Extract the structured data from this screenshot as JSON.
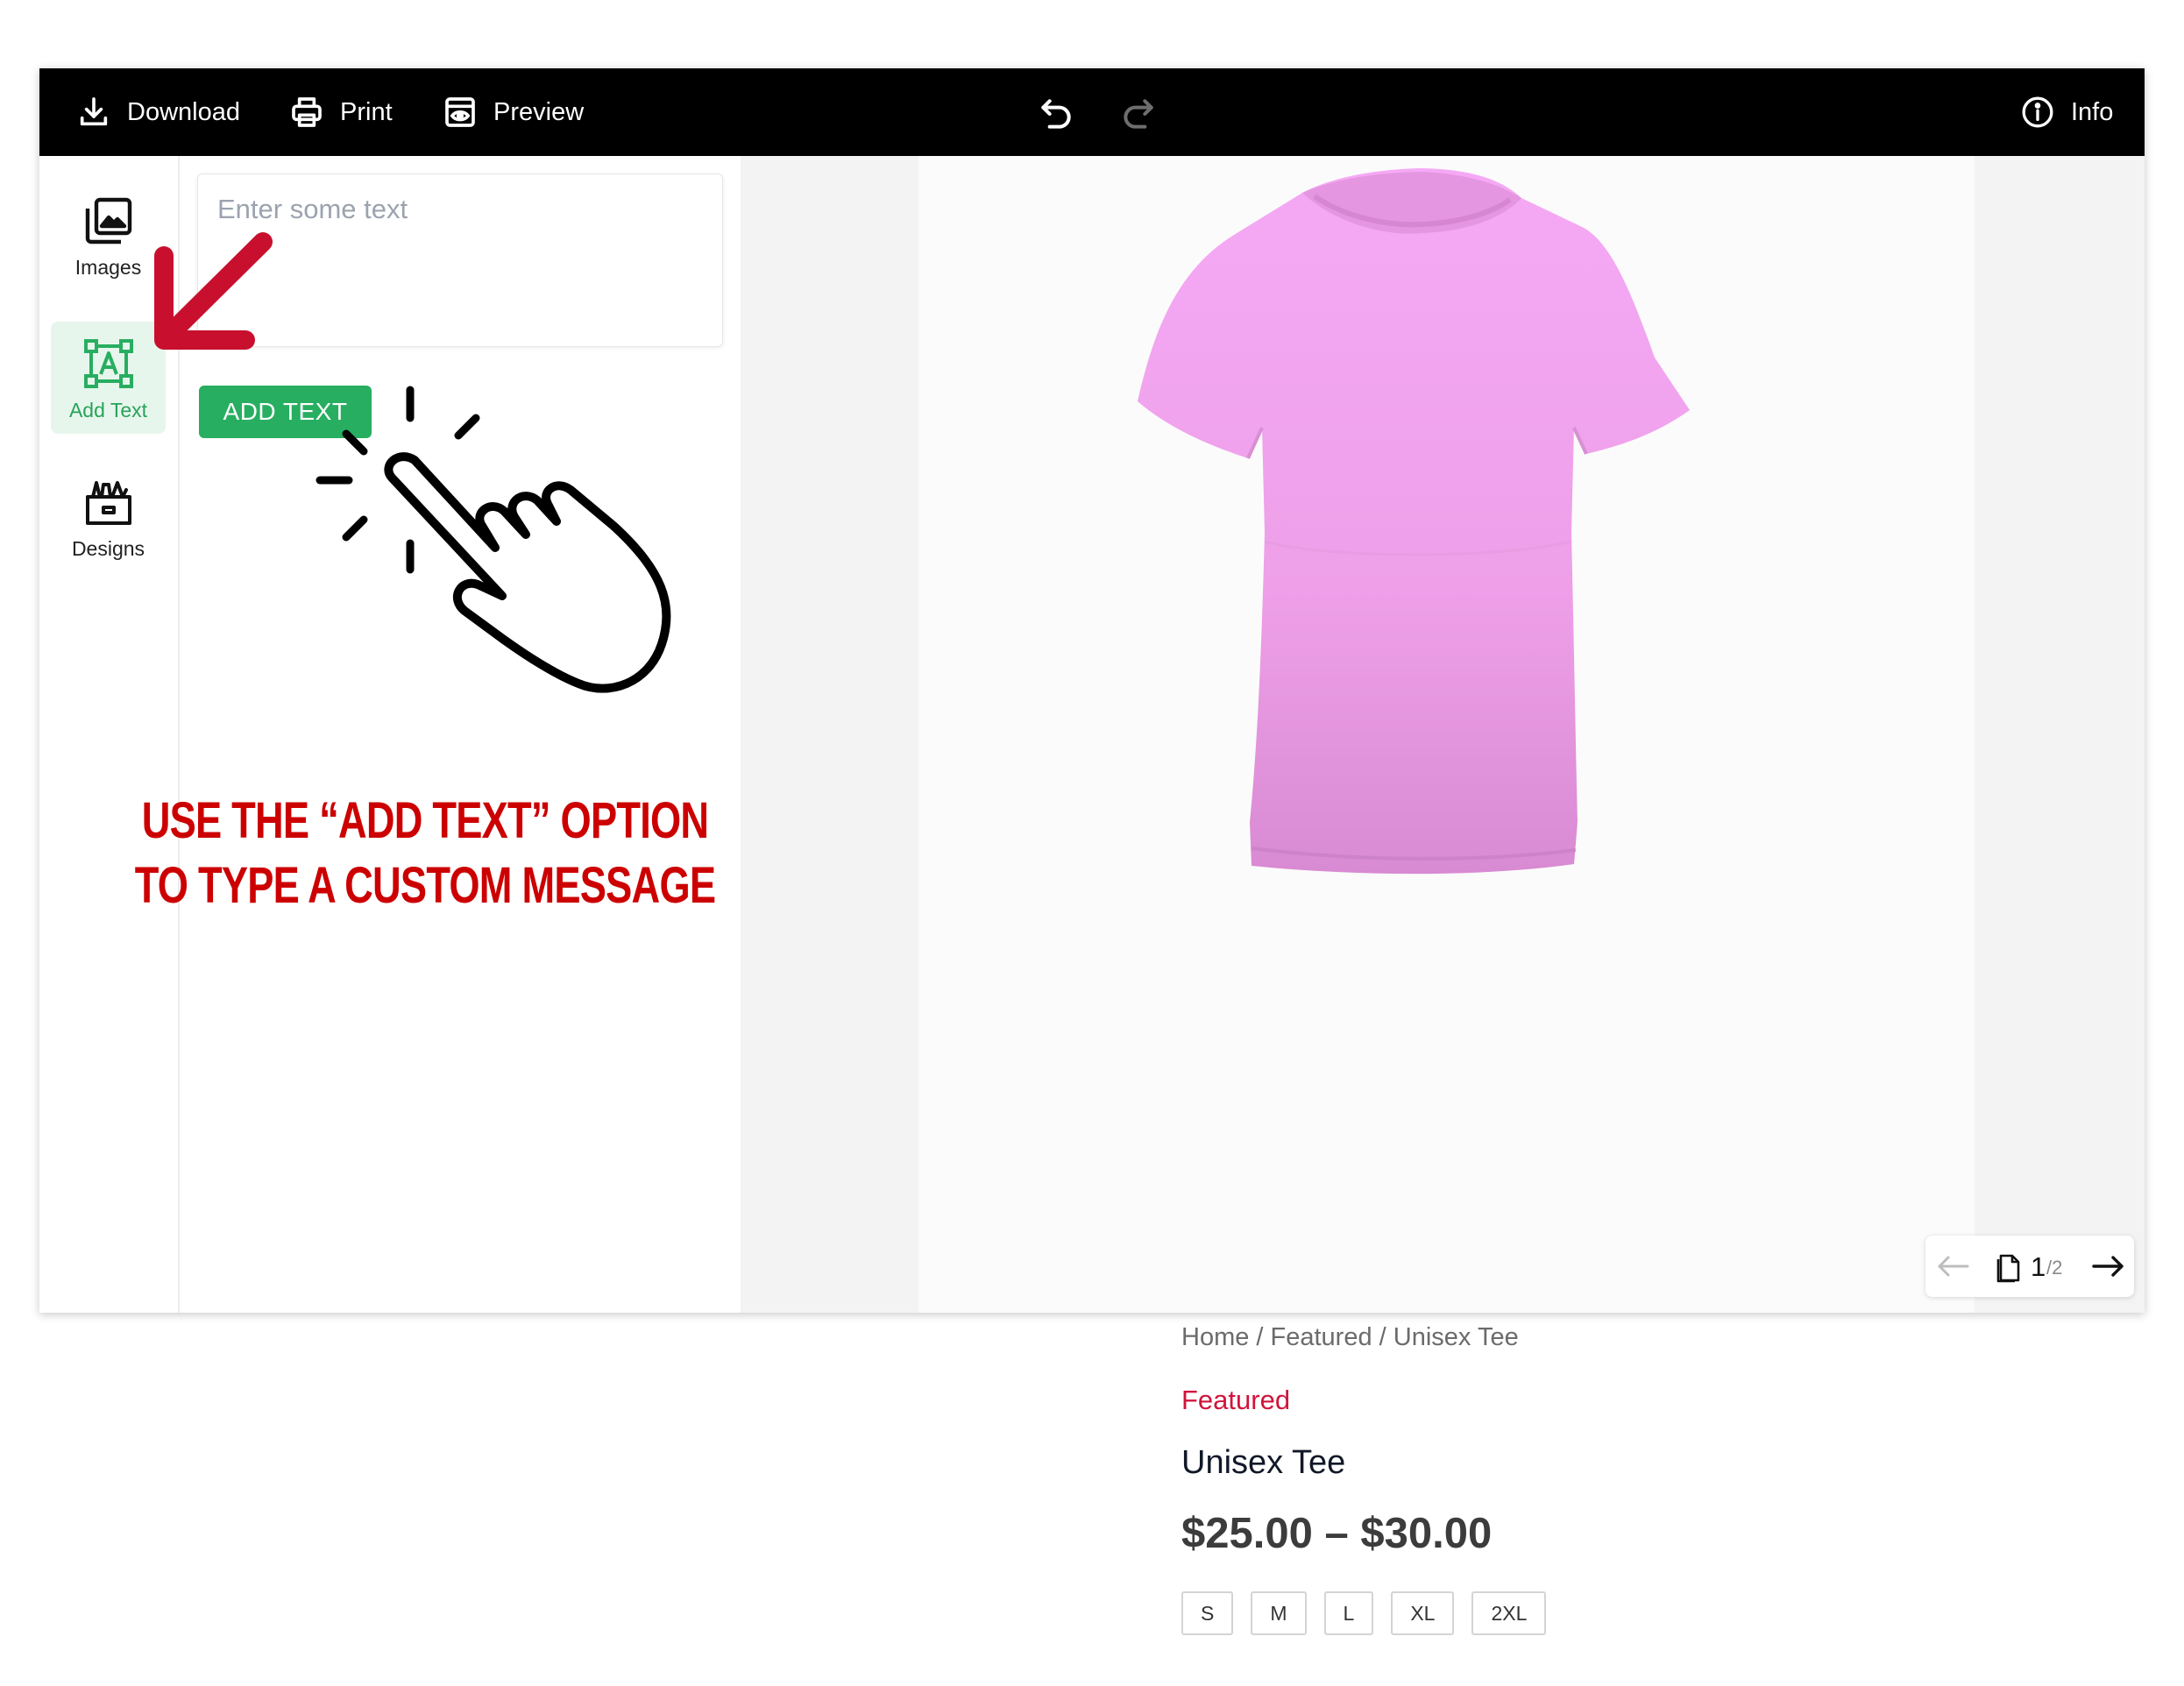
{
  "toolbar": {
    "download_label": "Download",
    "print_label": "Print",
    "preview_label": "Preview",
    "info_label": "Info"
  },
  "sidebar": {
    "items": [
      {
        "label": "Images",
        "icon": "images-icon"
      },
      {
        "label": "Add Text",
        "icon": "text-box-icon",
        "active": true
      },
      {
        "label": "Designs",
        "icon": "designs-box-icon"
      }
    ]
  },
  "text_panel": {
    "placeholder": "Enter some text",
    "value": "",
    "add_button_label": "ADD TEXT"
  },
  "annotation": {
    "line1": "USE THE “ADD TEXT” OPTION",
    "line2": "TO TYPE A CUSTOM MESSAGE"
  },
  "canvas": {
    "product_image": "pink-tshirt",
    "shirt_color": "#f2a6f0"
  },
  "page_nav": {
    "current": "1",
    "total": "/2"
  },
  "product": {
    "breadcrumb": "Home / Featured / Unisex Tee",
    "category": "Featured",
    "title": "Unisex Tee",
    "price": "$25.00 – $30.00",
    "sizes": [
      "S",
      "M",
      "L",
      "XL",
      "2XL"
    ]
  },
  "colors": {
    "accent_green": "#27ae60",
    "annotation_red": "#cc0000",
    "category_red": "#d1143c",
    "toolbar_bg": "#000000"
  }
}
